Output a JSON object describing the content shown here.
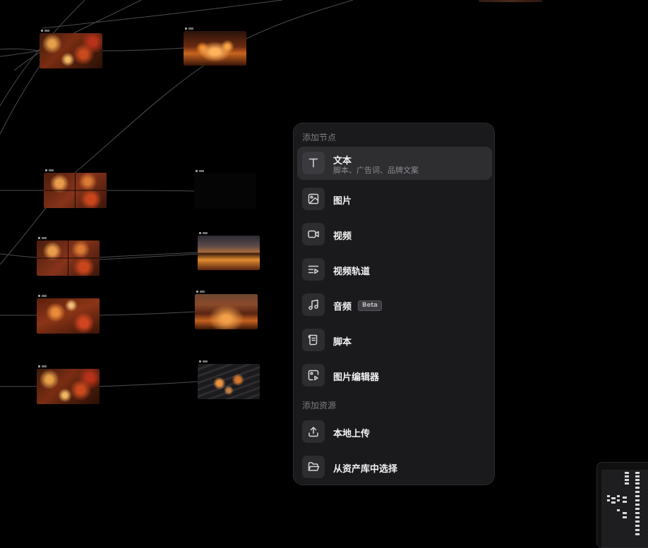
{
  "menu": {
    "section_nodes_title": "添加节点",
    "section_assets_title": "添加资源",
    "items": [
      {
        "label": "文本",
        "sub": "脚本、广告词、品牌文案",
        "icon": "text-icon"
      },
      {
        "label": "图片",
        "icon": "image-icon"
      },
      {
        "label": "视频",
        "icon": "video-camera-icon"
      },
      {
        "label": "视频轨道",
        "icon": "video-track-icon"
      },
      {
        "label": "音频",
        "badge": "Beta",
        "icon": "music-note-icon"
      },
      {
        "label": "脚本",
        "icon": "script-scroll-icon"
      },
      {
        "label": "图片编辑器",
        "icon": "image-editor-icon"
      },
      {
        "label": "本地上传",
        "icon": "upload-icon"
      },
      {
        "label": "从资产库中选择",
        "icon": "folder-open-icon"
      }
    ]
  },
  "colors": {
    "canvas_bg": "#000000",
    "menu_bg": "#1a1a1c",
    "active_item_bg": "#2e2e31",
    "edge_line": "#5a5a5e"
  }
}
